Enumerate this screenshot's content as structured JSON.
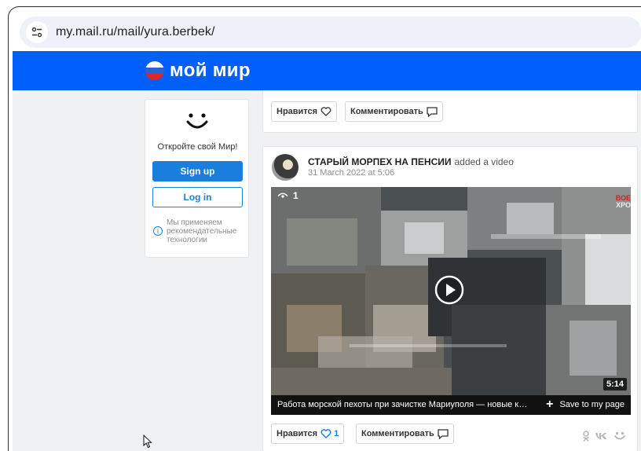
{
  "browser": {
    "url": "my.mail.ru/mail/yura.berbek/",
    "site_info_icon": "tune-icon"
  },
  "header": {
    "logo_text": "мой мир",
    "colors": {
      "bar": "#005ff9",
      "flag_white": "#ffffff",
      "flag_blue": "#2d5fd3",
      "flag_red": "#e0242a"
    }
  },
  "signup_card": {
    "title": "Откройте свой Мир!",
    "signup_label": "Sign up",
    "login_label": "Log in",
    "info_text": "Мы применяем рекомендательные технологии",
    "info_icon_glyph": "i"
  },
  "post_previous": {
    "like_label": "Нравится",
    "comment_label": "Комментировать"
  },
  "post": {
    "author": "СТАРЫЙ МОРПЕХ НА ПЕНСИИ",
    "action": "added a video",
    "date": "31 March 2022 at 5:06",
    "video": {
      "views": "1",
      "channel_tag_top": "ВОЕ",
      "channel_tag_bottom": "ХРО",
      "duration": "5:14",
      "caption": "Работа морской пехоты при зачистке Мариуполя — новые кадры",
      "save_label": "Save to my page",
      "save_glyph": "+"
    },
    "like_label": "Нравится",
    "like_count": "1",
    "comment_label": "Комментировать",
    "share_icons": [
      "ok-icon",
      "vk-icon",
      "moymir-icon"
    ]
  },
  "colors": {
    "accent": "#1a7ede",
    "page_bg": "#f0f1f3"
  }
}
